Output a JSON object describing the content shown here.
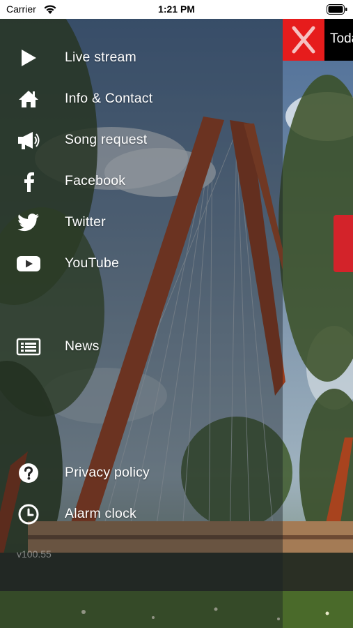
{
  "status_bar": {
    "carrier": "Carrier",
    "time": "1:21 PM"
  },
  "drawer": {
    "items": [
      {
        "label": "Live stream",
        "icon": "play-icon"
      },
      {
        "label": "Info & Contact",
        "icon": "home-icon"
      },
      {
        "label": "Song request",
        "icon": "megaphone-icon"
      },
      {
        "label": "Facebook",
        "icon": "facebook-icon"
      },
      {
        "label": "Twitter",
        "icon": "twitter-icon"
      },
      {
        "label": "YouTube",
        "icon": "youtube-icon"
      },
      {
        "label": "News",
        "icon": "news-icon"
      },
      {
        "label": "Privacy policy",
        "icon": "question-icon"
      },
      {
        "label": "Alarm clock",
        "icon": "clock-icon"
      }
    ],
    "version": "v100.55"
  },
  "peek": {
    "title": "Toda",
    "close_icon": "close-icon",
    "accent_color": "#e61c1c"
  }
}
